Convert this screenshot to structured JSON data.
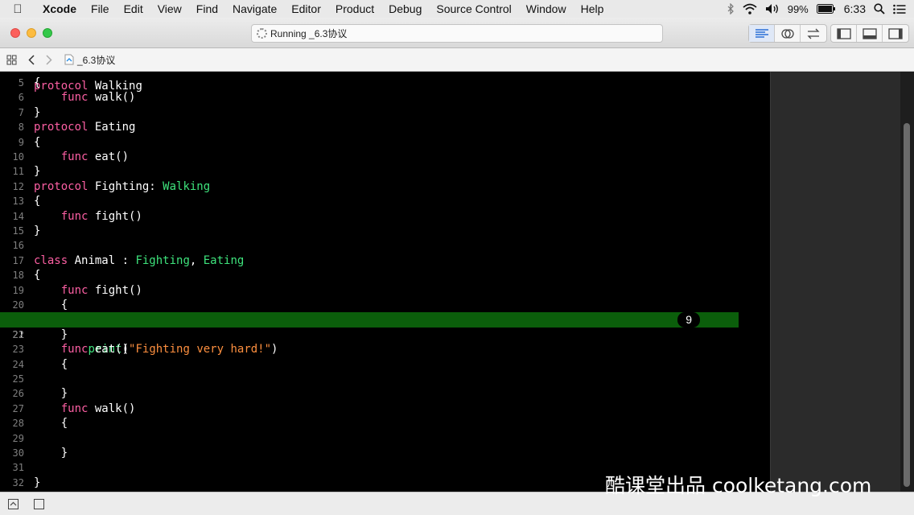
{
  "menubar": {
    "app": "Xcode",
    "menus": [
      "File",
      "Edit",
      "View",
      "Find",
      "Navigate",
      "Editor",
      "Product",
      "Debug",
      "Source Control",
      "Window",
      "Help"
    ],
    "battery": "99%",
    "clock": "6:33"
  },
  "toolbar": {
    "activity": "Running _6.3协议"
  },
  "jumpbar": {
    "file": "_6.3协议"
  },
  "editor": {
    "current_line": "21",
    "result_count": "9",
    "lines": [
      {
        "n": "5",
        "t": "{"
      },
      {
        "n": "6",
        "t": "    func walk()"
      },
      {
        "n": "7",
        "t": "}"
      },
      {
        "n": "8",
        "t": "protocol Eating"
      },
      {
        "n": "9",
        "t": "{"
      },
      {
        "n": "10",
        "t": "    func eat()"
      },
      {
        "n": "11",
        "t": "}"
      },
      {
        "n": "12",
        "t": "protocol Fighting: Walking"
      },
      {
        "n": "13",
        "t": "{"
      },
      {
        "n": "14",
        "t": "    func fight()"
      },
      {
        "n": "15",
        "t": "}"
      },
      {
        "n": "16",
        "t": ""
      },
      {
        "n": "17",
        "t": "class Animal : Fighting, Eating"
      },
      {
        "n": "18",
        "t": "{"
      },
      {
        "n": "19",
        "t": "    func fight()"
      },
      {
        "n": "20",
        "t": "    {"
      },
      {
        "n": "21",
        "t": "        print(\"Fighting very hard!\")"
      },
      {
        "n": "22",
        "t": "    }"
      },
      {
        "n": "23",
        "t": "    func eat()"
      },
      {
        "n": "24",
        "t": "    {"
      },
      {
        "n": "25",
        "t": ""
      },
      {
        "n": "26",
        "t": "    }"
      },
      {
        "n": "27",
        "t": "    func walk()"
      },
      {
        "n": "28",
        "t": "    {"
      },
      {
        "n": "29",
        "t": ""
      },
      {
        "n": "30",
        "t": "    }"
      },
      {
        "n": "31",
        "t": ""
      },
      {
        "n": "32",
        "t": "}"
      }
    ]
  },
  "colors": {
    "keyword": "#fc5fa3",
    "type": "#3ee37c",
    "string": "#fd8f3f",
    "current_line_bg": "#0b5e0b"
  },
  "watermark": "酷课堂出品 coolketang.com"
}
